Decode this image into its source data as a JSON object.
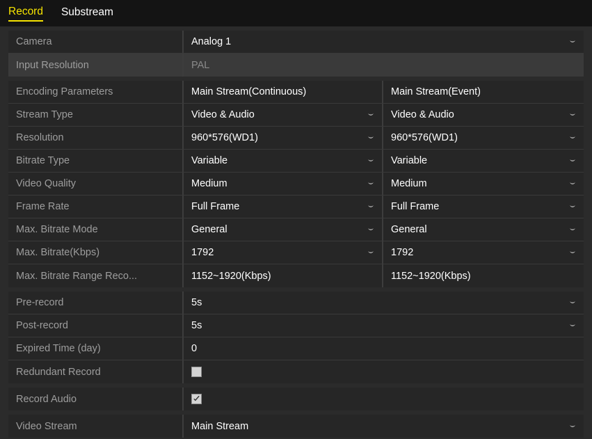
{
  "tabs": [
    {
      "label": "Record",
      "active": true
    },
    {
      "label": "Substream",
      "active": false
    }
  ],
  "colors": {
    "accent": "#f7e400",
    "panel_bg": "#2b2b2b",
    "row_bg": "#262626",
    "row_disabled_bg": "#3a3a3a",
    "label_text": "#9d9d9d",
    "value_text": "#ffffff"
  },
  "icons": {
    "caret": "chevron-down-icon",
    "check": "checkmark-icon"
  },
  "groups": [
    {
      "name": "camera-group",
      "rows": [
        {
          "name": "camera",
          "label": "Camera",
          "type": "select",
          "value": "Analog 1",
          "disabled": false
        },
        {
          "name": "input-resolution",
          "label": "Input Resolution",
          "type": "readonly",
          "value": "PAL",
          "disabled": true
        }
      ]
    },
    {
      "name": "encoding-group",
      "rows": [
        {
          "name": "encoding-parameters",
          "label": "Encoding Parameters",
          "type": "split-header",
          "value": "Main Stream(Continuous)",
          "value2": "Main Stream(Event)",
          "disabled": false
        },
        {
          "name": "stream-type",
          "label": "Stream Type",
          "type": "split-select",
          "value": "Video & Audio",
          "value2": "Video & Audio",
          "disabled": false
        },
        {
          "name": "resolution",
          "label": "Resolution",
          "type": "split-select",
          "value": "960*576(WD1)",
          "value2": "960*576(WD1)",
          "disabled": false
        },
        {
          "name": "bitrate-type",
          "label": "Bitrate Type",
          "type": "split-select",
          "value": "Variable",
          "value2": "Variable",
          "disabled": false
        },
        {
          "name": "video-quality",
          "label": "Video Quality",
          "type": "split-select",
          "value": "Medium",
          "value2": "Medium",
          "disabled": false
        },
        {
          "name": "frame-rate",
          "label": "Frame Rate",
          "type": "split-select",
          "value": "Full Frame",
          "value2": "Full Frame",
          "disabled": false
        },
        {
          "name": "max-bitrate-mode",
          "label": "Max. Bitrate Mode",
          "type": "split-select",
          "value": "General",
          "value2": "General",
          "disabled": false
        },
        {
          "name": "max-bitrate-kbps",
          "label": "Max. Bitrate(Kbps)",
          "type": "split-select",
          "value": "1792",
          "value2": "1792",
          "disabled": false
        },
        {
          "name": "max-bitrate-range-recommended",
          "label": "Max. Bitrate Range Reco...",
          "type": "split-readonly",
          "value": "1152~1920(Kbps)",
          "value2": "1152~1920(Kbps)",
          "disabled": false
        }
      ]
    },
    {
      "name": "record-settings-group",
      "rows": [
        {
          "name": "pre-record",
          "label": "Pre-record",
          "type": "select",
          "value": "5s",
          "disabled": false
        },
        {
          "name": "post-record",
          "label": "Post-record",
          "type": "select",
          "value": "5s",
          "disabled": false
        },
        {
          "name": "expired-time-day",
          "label": "Expired Time (day)",
          "type": "text",
          "value": "0",
          "disabled": false
        },
        {
          "name": "redundant-record",
          "label": "Redundant Record",
          "type": "checkbox",
          "checked": false,
          "disabled": false
        }
      ]
    },
    {
      "name": "audio-group",
      "rows": [
        {
          "name": "record-audio",
          "label": "Record Audio",
          "type": "checkbox",
          "checked": true,
          "disabled": false
        }
      ]
    },
    {
      "name": "video-stream-group",
      "rows": [
        {
          "name": "video-stream",
          "label": "Video Stream",
          "type": "select",
          "value": "Main Stream",
          "disabled": false
        }
      ]
    }
  ]
}
